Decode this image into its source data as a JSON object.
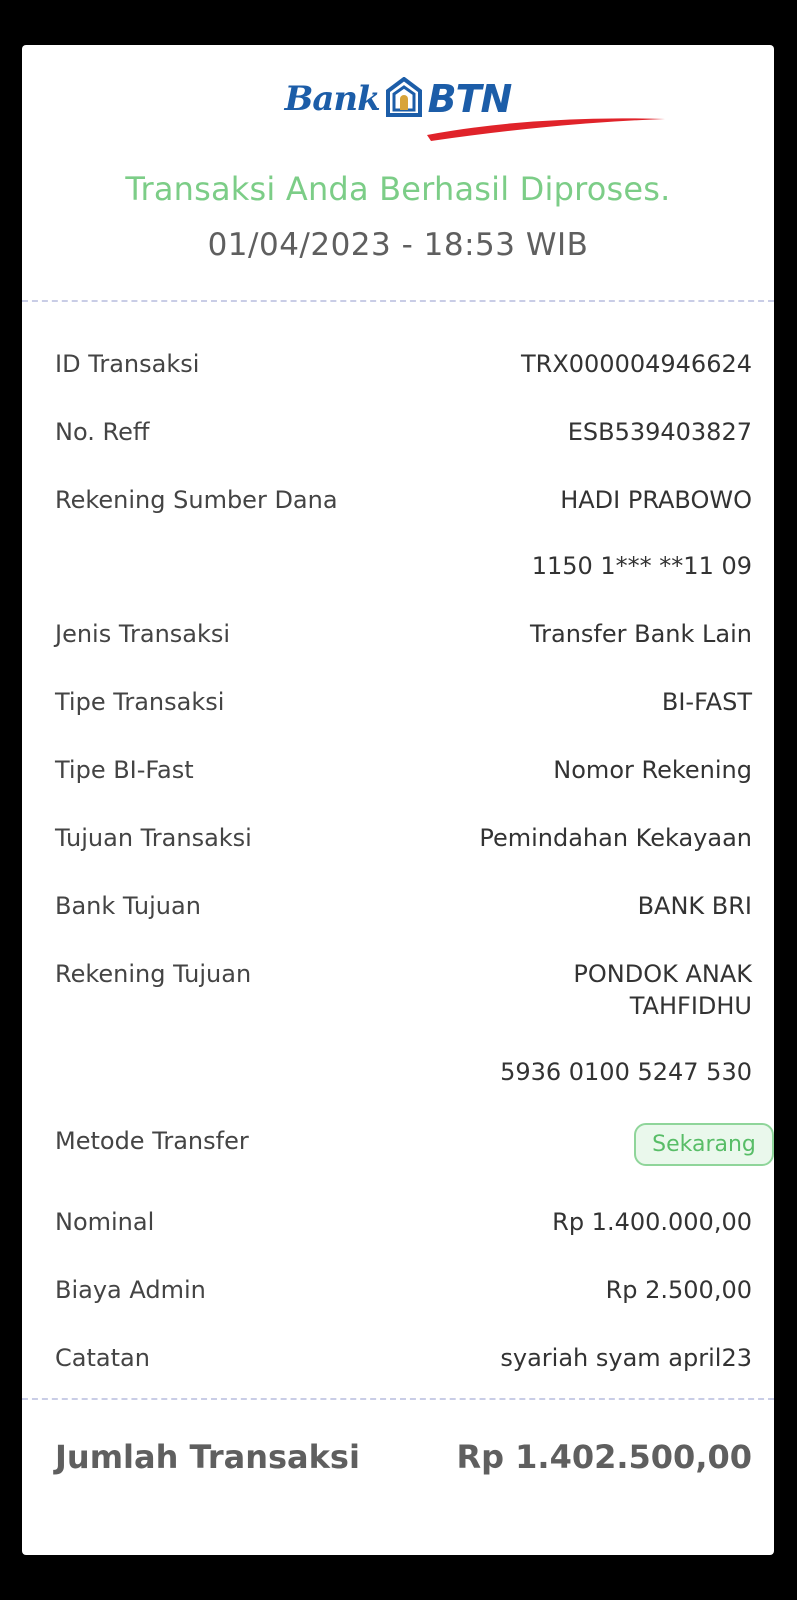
{
  "brand": {
    "bank": "Bank",
    "name": "BTN"
  },
  "status_message": "Transaksi Anda Berhasil Diproses.",
  "datetime": "01/04/2023 - 18:53 WIB",
  "details": {
    "id_transaksi": {
      "label": "ID Transaksi",
      "value": "TRX000004946624"
    },
    "no_reff": {
      "label": "No. Reff",
      "value": "ESB539403827"
    },
    "rekening_sumber": {
      "label": "Rekening Sumber Dana",
      "name": "HADI PRABOWO",
      "number": "1150 1*** **11 09"
    },
    "jenis_transaksi": {
      "label": "Jenis Transaksi",
      "value": "Transfer Bank Lain"
    },
    "tipe_transaksi": {
      "label": "Tipe Transaksi",
      "value": "BI-FAST"
    },
    "tipe_bifast": {
      "label": "Tipe BI-Fast",
      "value": "Nomor Rekening"
    },
    "tujuan_transaksi": {
      "label": "Tujuan Transaksi",
      "value": "Pemindahan Kekayaan"
    },
    "bank_tujuan": {
      "label": "Bank Tujuan",
      "value": "BANK BRI"
    },
    "rekening_tujuan": {
      "label": "Rekening Tujuan",
      "name_line1": "PONDOK ANAK",
      "name_line2": "TAHFIDHU",
      "number": "5936 0100 5247 530"
    },
    "metode_transfer": {
      "label": "Metode Transfer",
      "badge": "Sekarang"
    },
    "nominal": {
      "label": "Nominal",
      "value": "Rp 1.400.000,00"
    },
    "biaya_admin": {
      "label": "Biaya Admin",
      "value": "Rp 2.500,00"
    },
    "catatan": {
      "label": "Catatan",
      "value": "syariah syam april23"
    }
  },
  "total": {
    "label": "Jumlah Transaksi",
    "value": "Rp 1.402.500,00"
  },
  "colors": {
    "brand_blue": "#1c5da8",
    "brand_red": "#e0232a",
    "success_green": "#7ccd87",
    "badge_green": "#58bd67"
  },
  "icons": {
    "logo_mark": "house-icon"
  }
}
